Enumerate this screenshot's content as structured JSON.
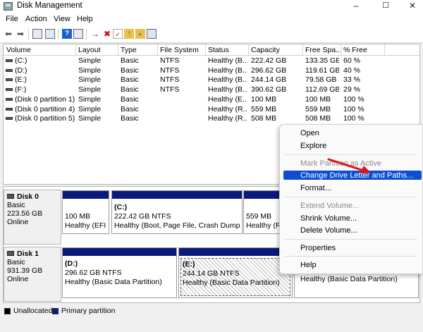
{
  "window": {
    "title": "Disk Management",
    "minimize": "–",
    "maximize": "☐",
    "close": "✕"
  },
  "menubar": {
    "items": [
      "File",
      "Action",
      "View",
      "Help"
    ]
  },
  "toolbar": {
    "icons": [
      "back-arrow-icon",
      "forward-arrow-icon",
      "console-tree-icon",
      "properties-icon",
      "help-icon",
      "connect-icon",
      "delete-icon",
      "check-icon",
      "up-folder-icon",
      "search-folder-icon",
      "settings-list-icon"
    ]
  },
  "volume_list": {
    "headers": [
      "Volume",
      "Layout",
      "Type",
      "File System",
      "Status",
      "Capacity",
      "Free Spa...",
      "% Free"
    ],
    "rows": [
      [
        "(C:)",
        "Simple",
        "Basic",
        "NTFS",
        "Healthy (B...",
        "222.42 GB",
        "133.35 GB",
        "60 %"
      ],
      [
        "(D:)",
        "Simple",
        "Basic",
        "NTFS",
        "Healthy (B...",
        "296.62 GB",
        "119.61 GB",
        "40 %"
      ],
      [
        "(E:)",
        "Simple",
        "Basic",
        "NTFS",
        "Healthy (B...",
        "244.14 GB",
        "79.58 GB",
        "33 %"
      ],
      [
        "(F:)",
        "Simple",
        "Basic",
        "NTFS",
        "Healthy (B...",
        "390.62 GB",
        "112.69 GB",
        "29 %"
      ],
      [
        "(Disk 0 partition 1)",
        "Simple",
        "Basic",
        "",
        "Healthy (E...",
        "100 MB",
        "100 MB",
        "100 %"
      ],
      [
        "(Disk 0 partition 4)",
        "Simple",
        "Basic",
        "",
        "Healthy (R...",
        "559 MB",
        "559 MB",
        "100 %"
      ],
      [
        "(Disk 0 partition 5)",
        "Simple",
        "Basic",
        "",
        "Healthy (R...",
        "508 MB",
        "508 MB",
        "100 %"
      ]
    ]
  },
  "disks": [
    {
      "name": "Disk 0",
      "type": "Basic",
      "size": "223.56 GB",
      "status": "Online",
      "partitions": [
        {
          "title": "",
          "size": "100 MB",
          "status": "Healthy (EFI S"
        },
        {
          "title": "(C:)",
          "size": "222.42 GB NTFS",
          "status": "Healthy (Boot, Page File, Crash Dump, Ba"
        },
        {
          "title": "",
          "size": "559 MB",
          "status": "Healthy (Re"
        },
        {
          "title": "",
          "size": "",
          "status": ""
        }
      ]
    },
    {
      "name": "Disk 1",
      "type": "Basic",
      "size": "931.39 GB",
      "status": "Online",
      "partitions": [
        {
          "title": "(D:)",
          "size": "296.62 GB NTFS",
          "status": "Healthy (Basic Data Partition)"
        },
        {
          "title": "(E:)",
          "size": "244.14 GB NTFS",
          "status": "Healthy (Basic Data Partition)"
        },
        {
          "title": "",
          "size": "",
          "status": "Healthy (Basic Data Partition)"
        }
      ]
    }
  ],
  "legend": {
    "unallocated": "Unallocated",
    "primary": "Primary partition"
  },
  "context_menu": {
    "items": [
      {
        "label": "Open",
        "enabled": true
      },
      {
        "label": "Explore",
        "enabled": true
      },
      {
        "label": "Mark Partition as Active",
        "enabled": false
      },
      {
        "label": "Change Drive Letter and Paths...",
        "enabled": true,
        "highlighted": true
      },
      {
        "label": "Format...",
        "enabled": true
      },
      {
        "label": "Extend Volume...",
        "enabled": false
      },
      {
        "label": "Shrink Volume...",
        "enabled": true
      },
      {
        "label": "Delete Volume...",
        "enabled": true
      },
      {
        "label": "Properties",
        "enabled": true
      },
      {
        "label": "Help",
        "enabled": true
      }
    ]
  },
  "colors": {
    "primary_partition": "#0a1a7c",
    "highlight": "#0d4ed1",
    "arrow": "#e0141a",
    "unallocated": "#000000"
  }
}
